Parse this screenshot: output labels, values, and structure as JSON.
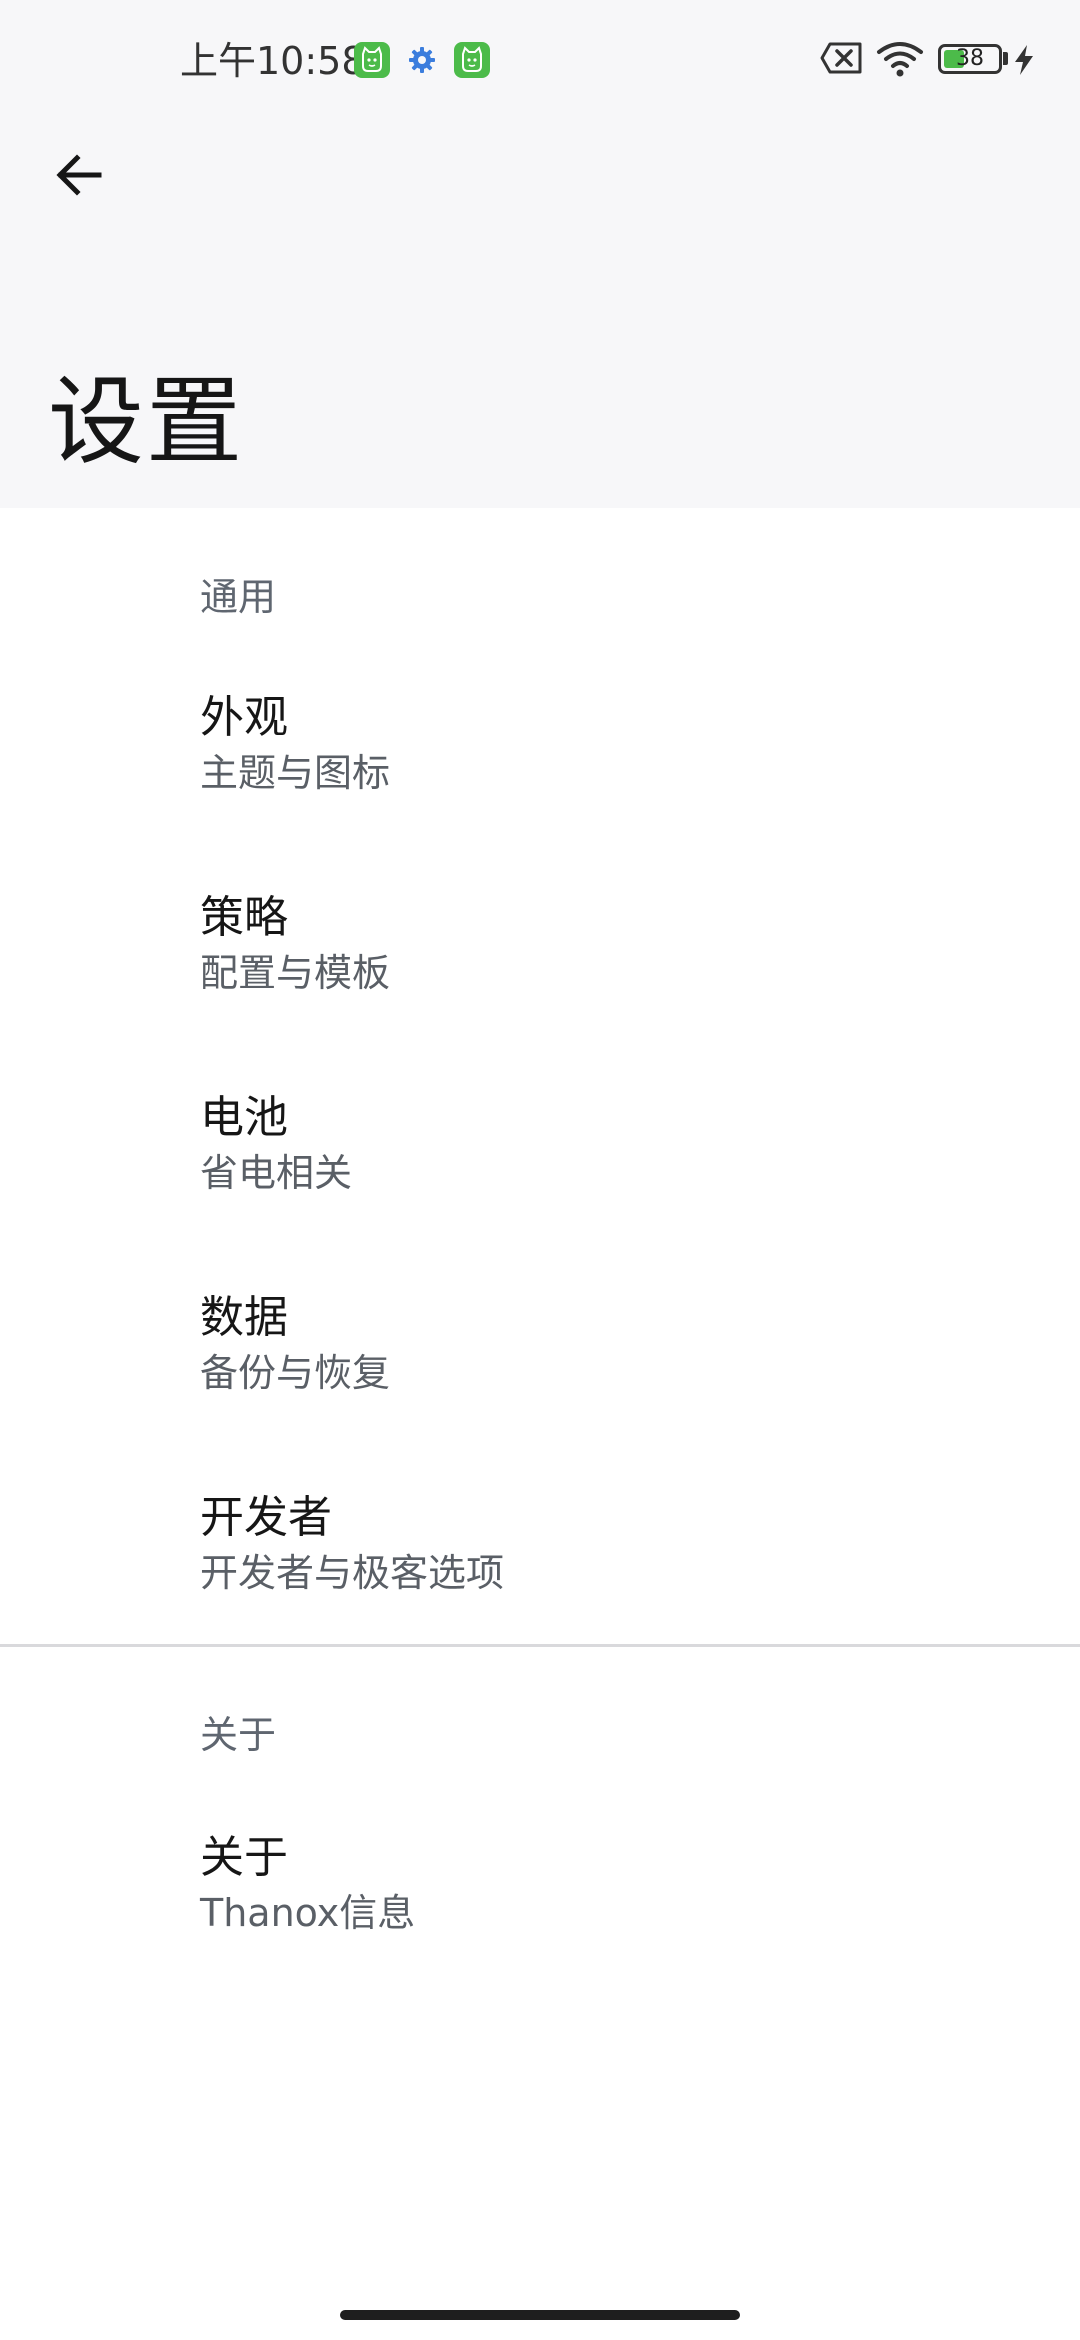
{
  "status_bar": {
    "time": "上午10:58",
    "battery_level": "38",
    "battery_fraction": 0.38,
    "icons": [
      "cat-notification-icon",
      "gear-notification-icon",
      "cat-notification-icon",
      "close-box-icon",
      "wifi-icon",
      "battery-icon",
      "charging-bolt-icon"
    ]
  },
  "toolbar": {
    "back_icon": "arrow-left-icon"
  },
  "page": {
    "title": "设置"
  },
  "sections": {
    "general": {
      "header": "通用",
      "items": [
        {
          "title": "外观",
          "summary": "主题与图标"
        },
        {
          "title": "策略",
          "summary": "配置与模板"
        },
        {
          "title": "电池",
          "summary": "省电相关"
        },
        {
          "title": "数据",
          "summary": "备份与恢复"
        },
        {
          "title": "开发者",
          "summary": "开发者与极客选项"
        }
      ]
    },
    "about": {
      "header": "关于",
      "items": [
        {
          "title": "关于",
          "summary": "Thanox信息"
        }
      ]
    }
  },
  "colors": {
    "header_bg": "#f7f7f9",
    "accent_green": "#4cbb4a",
    "section_header": "#5f6670",
    "gear_blue": "#3b7ddd"
  }
}
